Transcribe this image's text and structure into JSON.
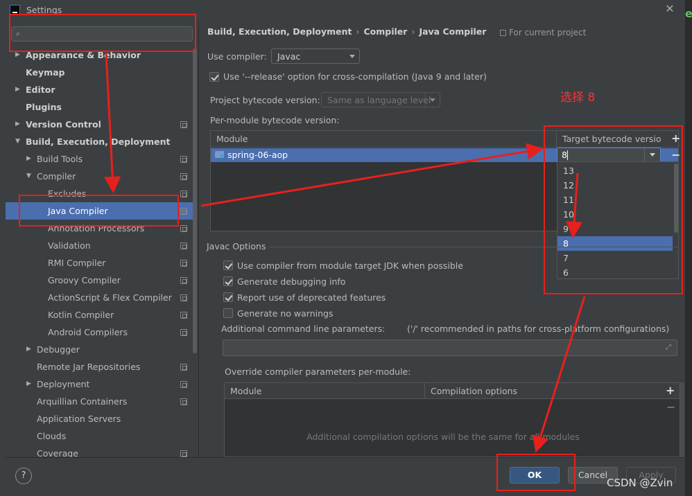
{
  "window": {
    "title": "Settings"
  },
  "search": {
    "placeholder": "",
    "value": ""
  },
  "sidebar": {
    "items": [
      {
        "label": "Appearance & Behavior"
      },
      {
        "label": "Keymap"
      },
      {
        "label": "Editor"
      },
      {
        "label": "Plugins"
      },
      {
        "label": "Version Control"
      },
      {
        "label": "Build, Execution, Deployment"
      },
      {
        "label": "Build Tools"
      },
      {
        "label": "Compiler"
      },
      {
        "label": "Excludes"
      },
      {
        "label": "Java Compiler"
      },
      {
        "label": "Annotation Processors"
      },
      {
        "label": "Validation"
      },
      {
        "label": "RMI Compiler"
      },
      {
        "label": "Groovy Compiler"
      },
      {
        "label": "ActionScript & Flex Compiler"
      },
      {
        "label": "Kotlin Compiler"
      },
      {
        "label": "Android Compilers"
      },
      {
        "label": "Debugger"
      },
      {
        "label": "Remote Jar Repositories"
      },
      {
        "label": "Deployment"
      },
      {
        "label": "Arquillian Containers"
      },
      {
        "label": "Application Servers"
      },
      {
        "label": "Clouds"
      },
      {
        "label": "Coverage"
      }
    ]
  },
  "breadcrumb": {
    "part1": "Build, Execution, Deployment",
    "sep": "›",
    "part2": "Compiler",
    "part3": "Java Compiler"
  },
  "for_current_project": "For current project",
  "use_compiler": {
    "label": "Use compiler:",
    "value": "Javac"
  },
  "release_option": {
    "label": "Use '--release' option for cross-compilation (Java 9 and later)",
    "checked": true
  },
  "project_bytecode": {
    "label": "Project bytecode version:",
    "value": "Same as language level"
  },
  "per_module": {
    "label": "Per-module bytecode version:",
    "col_module": "Module",
    "col_target": "Target bytecode version",
    "row_module": "spring-06-aop",
    "row_value": "8",
    "options": [
      "13",
      "12",
      "11",
      "10",
      "9",
      "8",
      "7",
      "6"
    ],
    "selected": "8"
  },
  "javac_options": {
    "title": "Javac Options",
    "checks": [
      {
        "label": "Use compiler from module target JDK when possible",
        "checked": true
      },
      {
        "label": "Generate debugging info",
        "checked": true
      },
      {
        "label": "Report use of deprecated features",
        "checked": true
      },
      {
        "label": "Generate no warnings",
        "checked": false
      }
    ],
    "additional_label": "Additional command line parameters:",
    "additional_hint": "('/' recommended in paths for cross-platform configurations)",
    "additional_value": ""
  },
  "override": {
    "label": "Override compiler parameters per-module:",
    "col_module": "Module",
    "col_options": "Compilation options",
    "empty_text": "Additional compilation options will be the same for all modules"
  },
  "buttons": {
    "help": "?",
    "ok": "OK",
    "cancel": "Cancel",
    "apply": "Apply"
  },
  "annotation": {
    "text": "选择 8"
  },
  "watermark": "CSDN @Zvin",
  "colors": {
    "accent": "#4b6eaf",
    "annotation": "#e8201c",
    "ok_button": "#365880"
  }
}
